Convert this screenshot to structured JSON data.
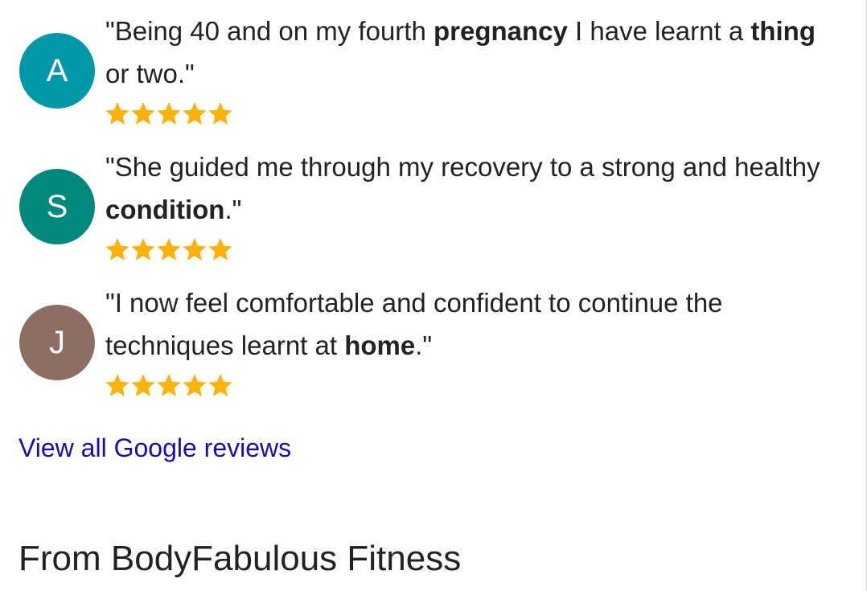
{
  "reviews": [
    {
      "initial": "A",
      "avatar_color": "#0097a7",
      "quote_parts": [
        "\"Being 40 and on my fourth ",
        "pregnancy",
        " I have learnt a ",
        "thing",
        " or two.\""
      ],
      "stars": 5
    },
    {
      "initial": "S",
      "avatar_color": "#00897b",
      "quote_parts": [
        "\"She guided me through my recovery to a strong and healthy ",
        "condition",
        ".\""
      ],
      "stars": 5
    },
    {
      "initial": "J",
      "avatar_color": "#8d6e63",
      "quote_parts": [
        "\"I now feel comfortable and confident to continue the techniques learnt at ",
        "home",
        ".\""
      ],
      "stars": 5
    }
  ],
  "star_color": "#fbb20a",
  "link_text": "View all Google reviews",
  "link_color": "#1a0dab",
  "section_title": "From BodyFabulous Fitness"
}
